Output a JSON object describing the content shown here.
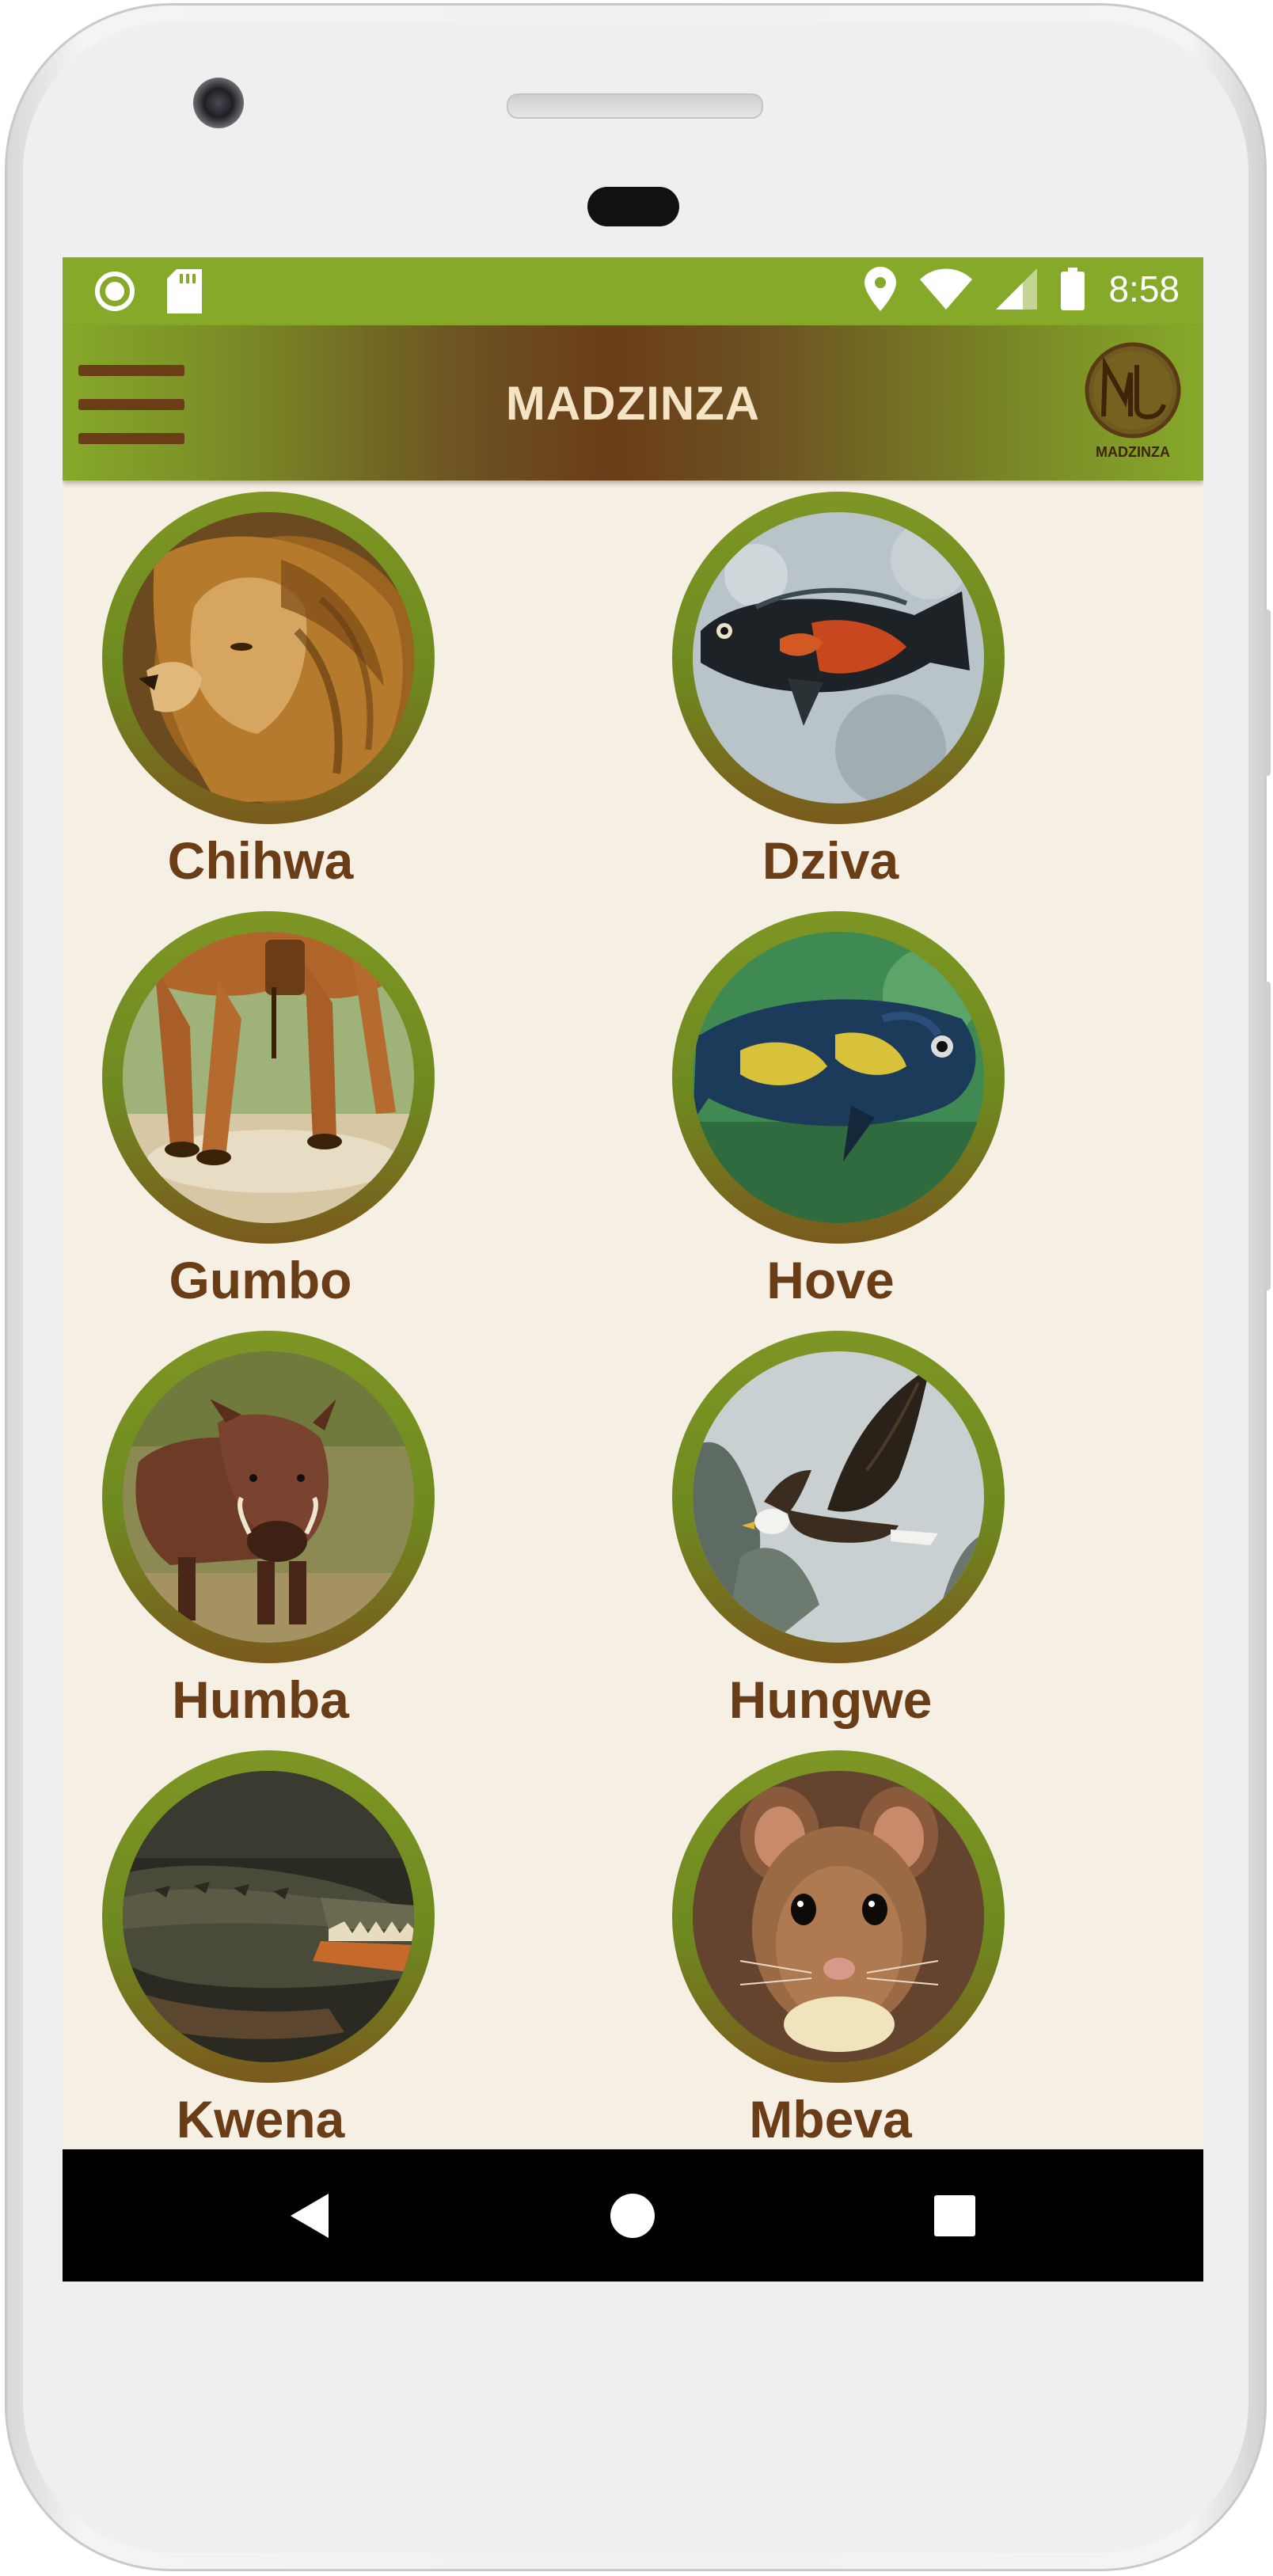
{
  "status_bar": {
    "time": "8:58",
    "left_icons": [
      "circle-notification-icon",
      "sd-card-icon"
    ],
    "right_icons": [
      "location-icon",
      "wifi-icon",
      "cell-signal-icon",
      "battery-icon"
    ]
  },
  "app_bar": {
    "title": "MADZINZA",
    "logo_text": "MADZINZA",
    "menu_icon": "hamburger-menu-icon"
  },
  "colors": {
    "primary_green": "#86a92a",
    "brown": "#6a3d17",
    "background": "#f6efe4",
    "title_text": "#f3e4c6"
  },
  "totems": [
    {
      "name": "Chihwa",
      "image": "lion"
    },
    {
      "name": "Dziva",
      "image": "fish-orange"
    },
    {
      "name": "Gumbo",
      "image": "horse-legs"
    },
    {
      "name": "Hove",
      "image": "fish-blue"
    },
    {
      "name": "Humba",
      "image": "warthog"
    },
    {
      "name": "Hungwe",
      "image": "eagle"
    },
    {
      "name": "Kwena",
      "image": "crocodile"
    },
    {
      "name": "Mbeva",
      "image": "mouse"
    }
  ],
  "nav_bar": {
    "buttons": [
      "back-icon",
      "home-icon",
      "recents-icon"
    ]
  }
}
